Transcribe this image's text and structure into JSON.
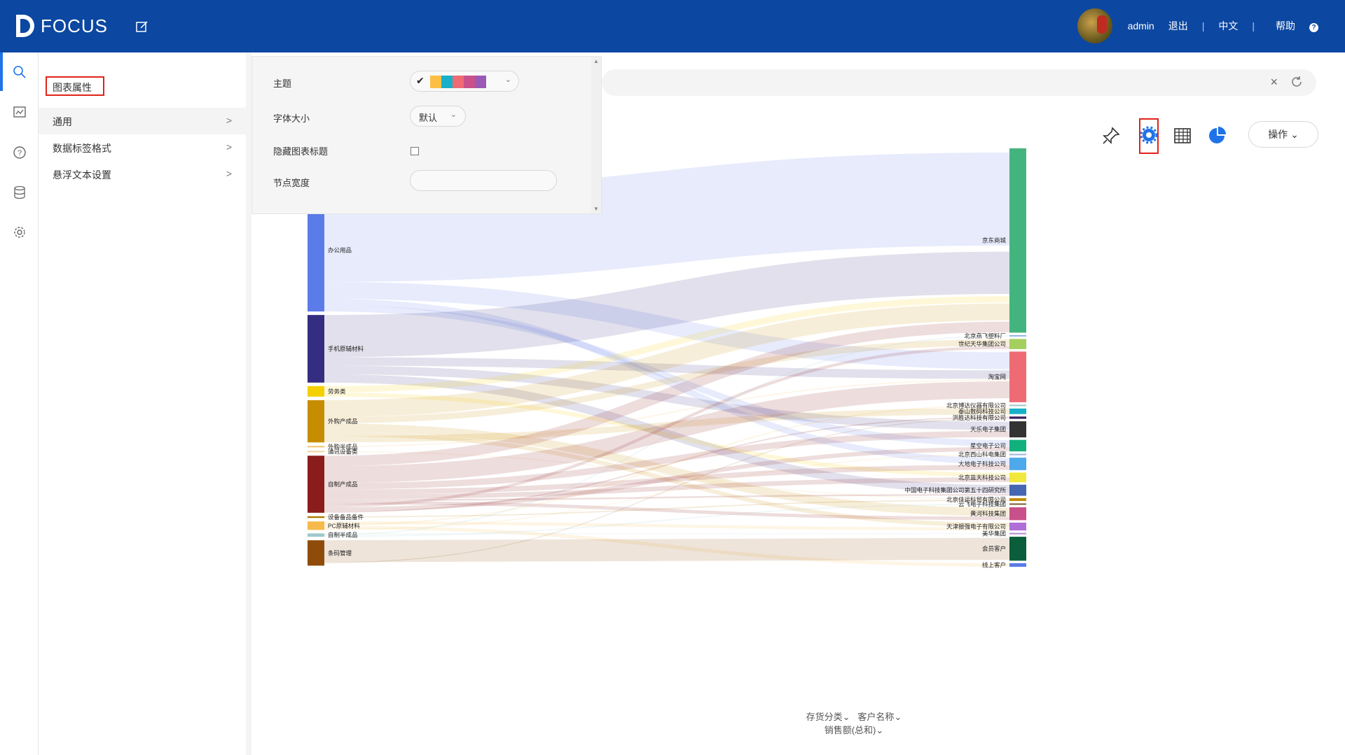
{
  "header": {
    "logo_text": "FOCUS",
    "user": "admin",
    "logout": "退出",
    "lang": "中文",
    "help": "帮助",
    "help_icon": "?"
  },
  "panel": {
    "title": "图表属性",
    "menu": [
      {
        "label": "通用",
        "chevron": ">"
      },
      {
        "label": "数据标签格式",
        "chevron": ">"
      },
      {
        "label": "悬浮文本设置",
        "chevron": ">"
      }
    ]
  },
  "props": {
    "theme_label": "主题",
    "theme_check": "✔",
    "theme_colors": [
      "#fbbf45",
      "#18b0c9",
      "#ef6b73",
      "#c8518b",
      "#9b59b6"
    ],
    "font_label": "字体大小",
    "font_value": "默认",
    "hide_title_label": "隐藏图表标题",
    "node_width_label": "节点宽度",
    "node_width_value": ""
  },
  "toolbar": {
    "operate": "操作"
  },
  "chart_data": {
    "type": "sankey",
    "left_nodes": [
      {
        "name": "办公用品",
        "color": "#5b7be9",
        "value": 29
      },
      {
        "name": "手机原辅材料",
        "color": "#342d80",
        "value": 16
      },
      {
        "name": "劳务类",
        "color": "#f5d000",
        "value": 2.5
      },
      {
        "name": "外购产成品",
        "color": "#c68d00",
        "value": 10
      },
      {
        "name": "外购半成品",
        "color": "#f5c36a",
        "value": 0.3
      },
      {
        "name": "通讯设备类",
        "color": "#f0d39a",
        "value": 0.3
      },
      {
        "name": "自制产成品",
        "color": "#8a1c1c",
        "value": 13.5
      },
      {
        "name": "设备备品备件",
        "color": "#b07a00",
        "value": 0.4
      },
      {
        "name": "PC原辅材料",
        "color": "#f6b94c",
        "value": 2
      },
      {
        "name": "自制半成品",
        "color": "#9ec9cc",
        "value": 0.8
      },
      {
        "name": "条码管理",
        "color": "#8f4b0a",
        "value": 6
      }
    ],
    "right_nodes": [
      {
        "name": "京东商城",
        "color": "#44b47e",
        "value": 40
      },
      {
        "name": "北京燕飞塑料厂",
        "color": "#8fb6e8",
        "value": 0.3
      },
      {
        "name": "世纪天华集团公司",
        "color": "#a4cf5e",
        "value": 2.2
      },
      {
        "name": "淘宝网",
        "color": "#ef6b73",
        "value": 11
      },
      {
        "name": "北京博达仪器有限公司",
        "color": "#9ec9cc",
        "value": 0.3
      },
      {
        "name": "泰山数码科技公司",
        "color": "#18b0c9",
        "value": 1.2
      },
      {
        "name": "洪胜达科技有限公司",
        "color": "#3a1f5c",
        "value": 0.5
      },
      {
        "name": "天乐电子集团",
        "color": "#333333",
        "value": 3.5
      },
      {
        "name": "星空电子公司",
        "color": "#12b07d",
        "value": 2.5
      },
      {
        "name": "北京西山科电集团",
        "color": "#9db4d9",
        "value": 0.2
      },
      {
        "name": "大地电子科技公司",
        "color": "#4da9ea",
        "value": 2.7
      },
      {
        "name": "北京蓝天科技公司",
        "color": "#f0e83c",
        "value": 2.1
      },
      {
        "name": "中国电子科技集团公司第五十四研究所",
        "color": "#4566b0",
        "value": 2.4
      },
      {
        "name": "北京佳运科贸有限公司",
        "color": "#c38a00",
        "value": 0.6
      },
      {
        "name": "云飞电子科技集团",
        "color": "#7a5a2d",
        "value": 0.2
      },
      {
        "name": "黄河科技集团",
        "color": "#c8518b",
        "value": 2.8
      },
      {
        "name": "天津振强电子有限公司",
        "color": "#b06ed8",
        "value": 1.7
      },
      {
        "name": "美华集团",
        "color": "#b38bd0",
        "value": 0.2
      },
      {
        "name": "会员客户",
        "color": "#0b5e3c",
        "value": 5.2
      },
      {
        "name": "线上客户",
        "color": "#5b7be9",
        "value": 0.8
      }
    ],
    "links": [
      {
        "source": 0,
        "target": 0,
        "value": 22
      },
      {
        "source": 0,
        "target": 3,
        "value": 4
      },
      {
        "source": 0,
        "target": 10,
        "value": 1.5
      },
      {
        "source": 0,
        "target": 8,
        "value": 1.5
      },
      {
        "source": 1,
        "target": 0,
        "value": 10
      },
      {
        "source": 1,
        "target": 3,
        "value": 2
      },
      {
        "source": 1,
        "target": 7,
        "value": 2
      },
      {
        "source": 1,
        "target": 12,
        "value": 2
      },
      {
        "source": 2,
        "target": 0,
        "value": 1.5
      },
      {
        "source": 2,
        "target": 11,
        "value": 1
      },
      {
        "source": 3,
        "target": 0,
        "value": 4
      },
      {
        "source": 3,
        "target": 2,
        "value": 1.5
      },
      {
        "source": 3,
        "target": 15,
        "value": 2
      },
      {
        "source": 3,
        "target": 16,
        "value": 1
      },
      {
        "source": 3,
        "target": 5,
        "value": 1.5
      },
      {
        "source": 4,
        "target": 3,
        "value": 0.3
      },
      {
        "source": 5,
        "target": 13,
        "value": 0.3
      },
      {
        "source": 6,
        "target": 0,
        "value": 2.5
      },
      {
        "source": 6,
        "target": 3,
        "value": 4
      },
      {
        "source": 6,
        "target": 7,
        "value": 1.5
      },
      {
        "source": 6,
        "target": 10,
        "value": 1.2
      },
      {
        "source": 6,
        "target": 11,
        "value": 1.1
      },
      {
        "source": 6,
        "target": 12,
        "value": 0.4
      },
      {
        "source": 6,
        "target": 15,
        "value": 0.8
      },
      {
        "source": 6,
        "target": 2,
        "value": 0.7
      },
      {
        "source": 6,
        "target": 8,
        "value": 1
      },
      {
        "source": 6,
        "target": 6,
        "value": 0.3
      },
      {
        "source": 7,
        "target": 13,
        "value": 0.3
      },
      {
        "source": 8,
        "target": 16,
        "value": 0.7
      },
      {
        "source": 8,
        "target": 4,
        "value": 0.3
      },
      {
        "source": 8,
        "target": 19,
        "value": 0.8
      },
      {
        "source": 8,
        "target": 9,
        "value": 0.2
      },
      {
        "source": 9,
        "target": 17,
        "value": 0.2
      },
      {
        "source": 9,
        "target": 1,
        "value": 0.3
      },
      {
        "source": 9,
        "target": 14,
        "value": 0.3
      },
      {
        "source": 10,
        "target": 18,
        "value": 5.2
      },
      {
        "source": 10,
        "target": 6,
        "value": 0.2
      },
      {
        "source": 10,
        "target": 19,
        "value": 0.0
      }
    ],
    "axis_fields": [
      "存货分类",
      "客户名称"
    ],
    "measure_field": "销售额(总和)"
  }
}
